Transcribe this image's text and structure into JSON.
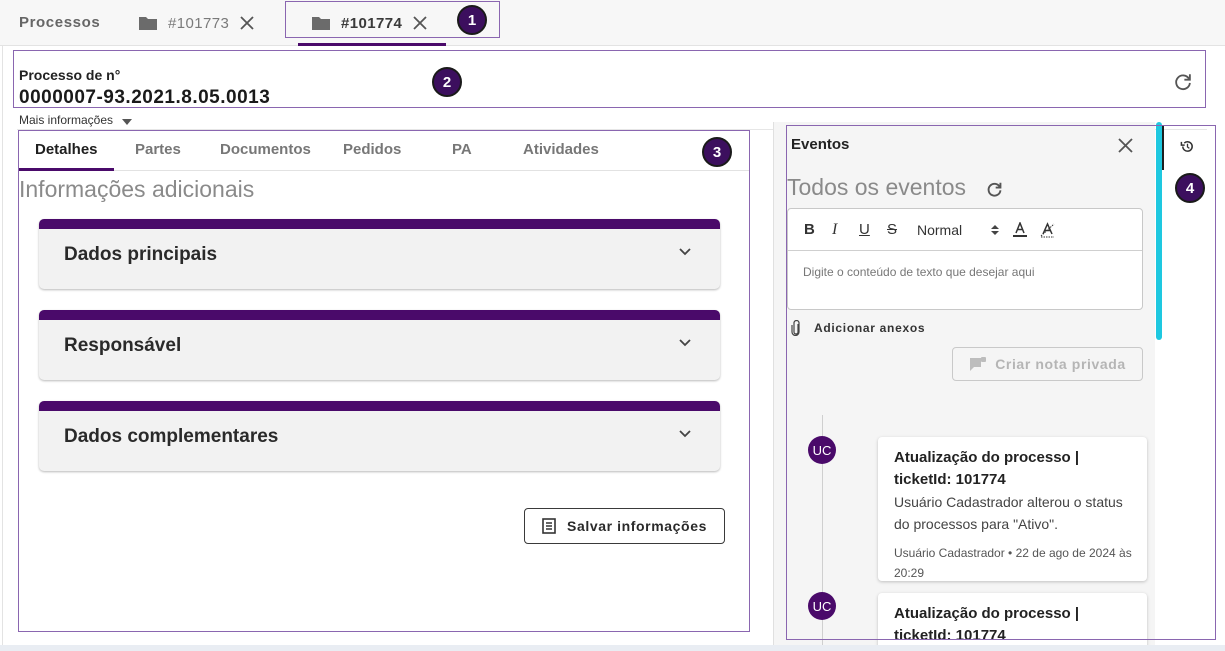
{
  "top": {
    "brand": "Processos",
    "tabs": [
      {
        "label": "#101773",
        "active": false
      },
      {
        "label": "#101774",
        "active": true
      }
    ]
  },
  "header": {
    "label": "Processo de n°",
    "number": "0000007-93.2021.8.05.0013",
    "more_info": "Mais informações"
  },
  "main": {
    "tabs": [
      "Detalhes",
      "Partes",
      "Documentos",
      "Pedidos",
      "PA",
      "Atividades"
    ],
    "section_title": "Informações adicionais",
    "accordions": [
      "Dados principais",
      "Responsável",
      "Dados complementares"
    ],
    "save_label": "Salvar informações"
  },
  "events": {
    "title": "Eventos",
    "subtitle": "Todos os eventos",
    "toolbar": {
      "bold": "B",
      "italic": "I",
      "underline": "U",
      "strike": "S",
      "format": "Normal"
    },
    "placeholder": "Digite o conteúdo de texto que desejar aqui",
    "attach_label": "Adicionar anexos",
    "private_note_label": "Criar nota privada",
    "items": [
      {
        "avatar": "UC",
        "title": "Atualização do processo | ticketId: 101774",
        "body": "Usuário Cadastrador alterou o status do processos para \"Ativo\".",
        "meta": "Usuário Cadastrador • 22 de ago de 2024 às 20:29"
      },
      {
        "avatar": "UC",
        "title": "Atualização do processo | ticketId: 101774"
      }
    ]
  },
  "annotations": [
    "1",
    "2",
    "3",
    "4"
  ],
  "colors": {
    "accent": "#4a0a6a",
    "scroll": "#1ec8e0",
    "annotation": "#8a66b0"
  }
}
